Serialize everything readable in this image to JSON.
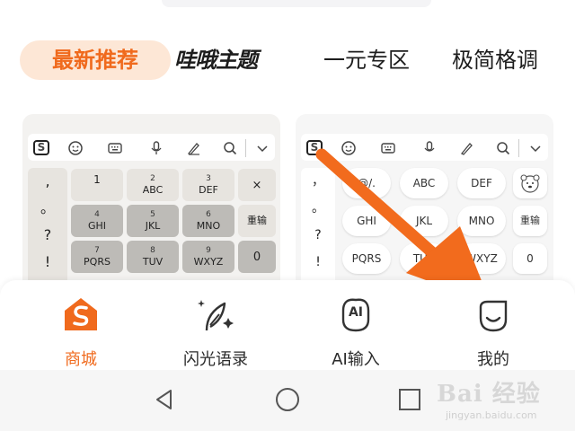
{
  "tabs": {
    "recommend": "最新推荐",
    "wawa": "哇哦主题",
    "yiyuan": "一元专区",
    "jijian": "极简格调"
  },
  "left_keyboard": {
    "toolbar_logo": "S",
    "symbols": [
      ",",
      "。",
      "?",
      "!"
    ],
    "keys": [
      {
        "n": "1",
        "l": ""
      },
      {
        "n": "2",
        "l": "ABC"
      },
      {
        "n": "3",
        "l": "DEF"
      },
      {
        "n": "4",
        "l": "GHI"
      },
      {
        "n": "5",
        "l": "JKL"
      },
      {
        "n": "6",
        "l": "MNO"
      },
      {
        "n": "7",
        "l": "PQRS"
      },
      {
        "n": "8",
        "l": "TUV"
      },
      {
        "n": "9",
        "l": "WXYZ"
      }
    ],
    "delete": "×",
    "reinput": "重输",
    "zero": "0"
  },
  "right_keyboard": {
    "toolbar_logo": "S",
    "symbols": [
      "，",
      "。",
      "?",
      "!"
    ],
    "keys": [
      "@/.",
      "ABC",
      "DEF",
      "GHI",
      "JKL",
      "MNO",
      "PQRS",
      "TUV",
      "WXYZ"
    ],
    "reinput": "重输",
    "zero": "0"
  },
  "bottom_nav": {
    "shop": "商城",
    "flash": "闪光语录",
    "ai": "AI输入",
    "mine": "我的",
    "ai_icon_text": "AI"
  },
  "watermark": {
    "main": "Bai 经验",
    "sub": "jingyan.baidu.com"
  },
  "colors": {
    "accent": "#f06a1d",
    "accent_bg": "#fde7d6",
    "arrow": "#f26b1d"
  }
}
